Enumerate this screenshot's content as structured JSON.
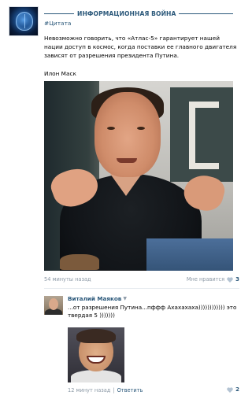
{
  "group": {
    "title": "ИНФОРМАЦИОННАЯ ВОЙНА",
    "hashtag": "#Цитата"
  },
  "post": {
    "text": "Невозможно говорить, что «Атлас-5» гарантирует нашей нации доступ в космос, когда поставки ее главного двигателя зависят от разрешения президента Путина.",
    "author": "Илон Маск",
    "time": "54 минуты назад",
    "like_label": "Мне нравится",
    "like_count": "3"
  },
  "comment": {
    "name": "Виталий Маяков",
    "text": "...от разрешения Путина...пффф Ахахахаха)))))))))))) это твердая 5 )))))))",
    "time": "12 минут назад",
    "separator": "|",
    "reply_label": "Ответить",
    "like_count": "2"
  },
  "colors": {
    "link": "#2b587a",
    "muted": "#8c99a6",
    "heart": "#b3c3d3"
  },
  "icons": [
    "group-avatar",
    "heart-icon",
    "chevron-down-icon"
  ]
}
